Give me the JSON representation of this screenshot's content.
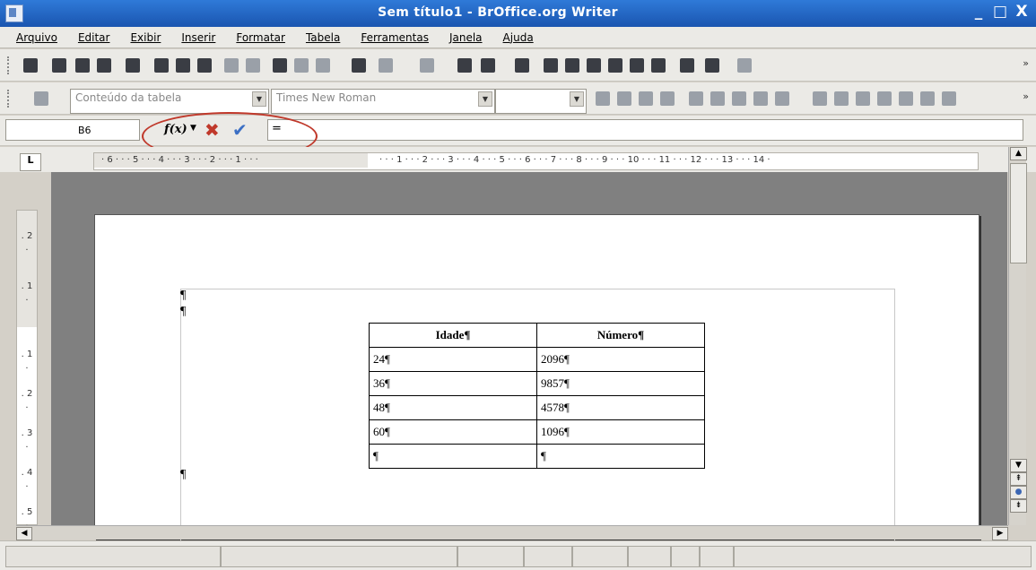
{
  "window": {
    "title": "Sem título1 - BrOffice.org Writer",
    "controls": [
      "_",
      "□",
      "X"
    ]
  },
  "menu": [
    "Arquivo",
    "Editar",
    "Exibir",
    "Inserir",
    "Formatar",
    "Tabela",
    "Ferramentas",
    "Janela",
    "Ajuda"
  ],
  "formatting": {
    "style_value": "Conteúdo da tabela",
    "font_value": "Times New Roman",
    "size_value": ""
  },
  "formula_bar": {
    "cell_ref": "B6",
    "fx_label": "f(x)",
    "formula_value": "="
  },
  "ruler": {
    "left_marks": "· 6 · · · 5 · · · 4 · · · 3 · · · 2 · · · 1 · · ·",
    "right_marks": "· · · 1 · · · 2 · · · 3 · · · 4 · · · 5 · · · 6 · · · 7 · · · 8 · · · 9 · · · 10 · · · 11 · · · 12 · · · 13 · · · 14 ·",
    "vertical_marks": [
      ". 2 .",
      ". 1 .",
      ". 1 .",
      ". 2 .",
      ". 3 .",
      ". 4 .",
      ". 5 ."
    ]
  },
  "icons": {
    "accent_red": "#c0392b",
    "accent_blue": "#3b6fc4",
    "title_blue": "#1a55b0"
  },
  "document": {
    "pilcrow": "¶",
    "table": {
      "headers": [
        "Idade¶",
        "Número¶"
      ],
      "rows": [
        [
          "24¶",
          "2096¶"
        ],
        [
          "36¶",
          "9857¶"
        ],
        [
          "48¶",
          "4578¶"
        ],
        [
          "60¶",
          "1096¶"
        ],
        [
          "¶",
          "¶"
        ]
      ]
    }
  }
}
